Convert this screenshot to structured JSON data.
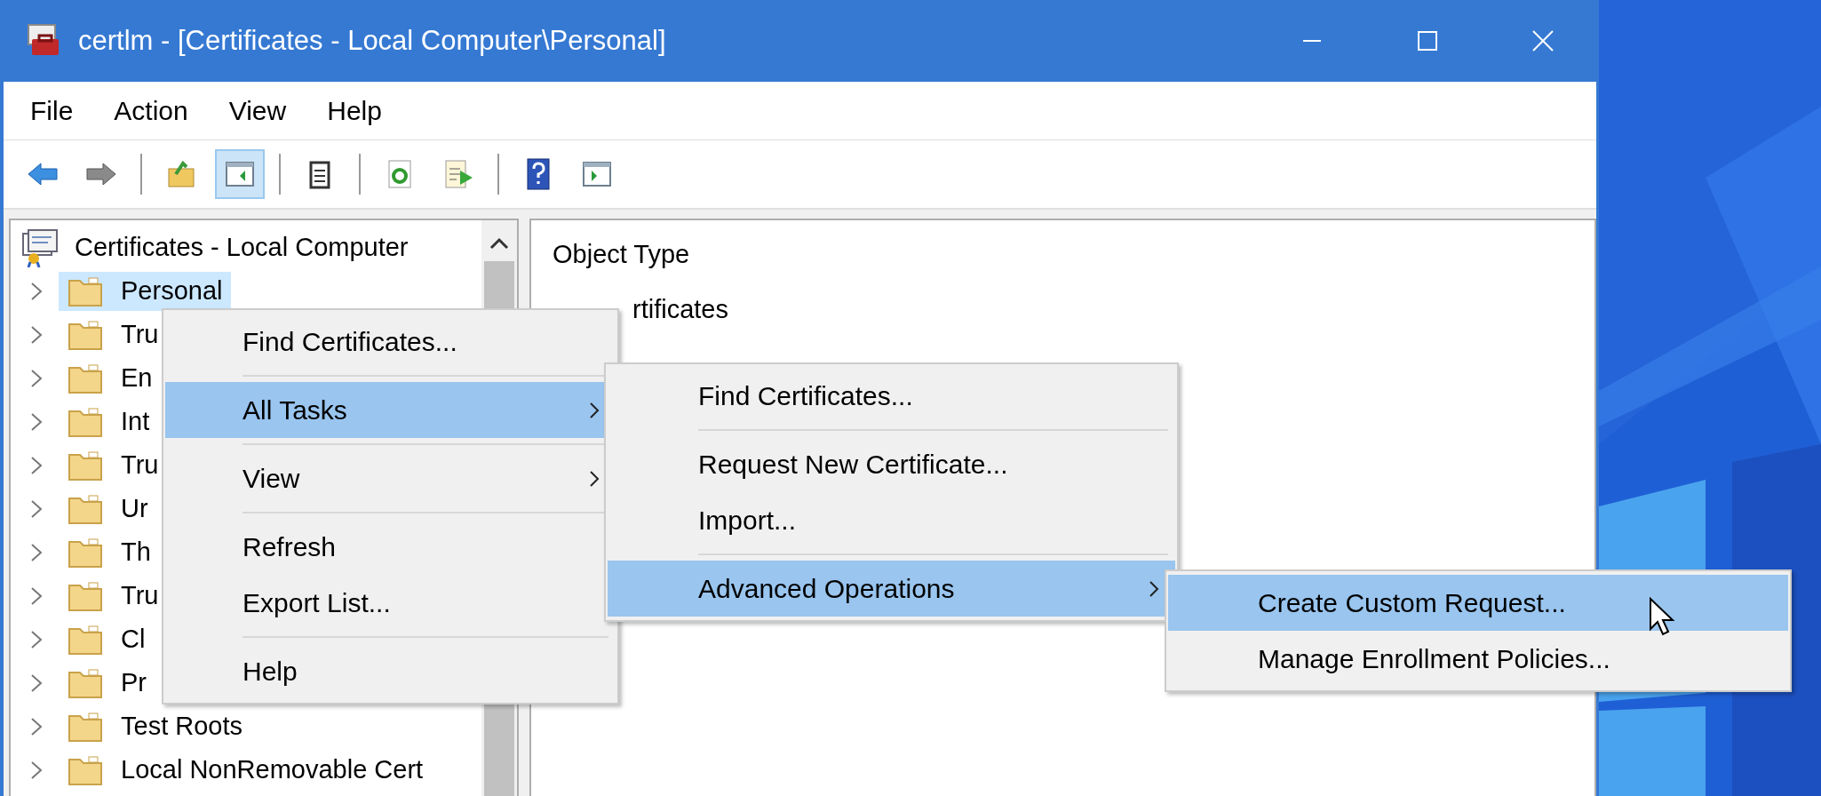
{
  "window": {
    "title": "certlm - [Certificates - Local Computer\\Personal]"
  },
  "menu_bar": [
    "File",
    "Action",
    "View",
    "Help"
  ],
  "toolbar": [
    [
      {
        "kind": "back",
        "pressed": false
      },
      {
        "kind": "forward",
        "pressed": false
      }
    ],
    [
      {
        "kind": "up",
        "pressed": false
      },
      {
        "kind": "tree",
        "pressed": true
      }
    ],
    [
      {
        "kind": "properties",
        "pressed": false
      }
    ],
    [
      {
        "kind": "refresh",
        "pressed": false
      },
      {
        "kind": "export",
        "pressed": false
      }
    ],
    [
      {
        "kind": "help",
        "pressed": false
      },
      {
        "kind": "pane",
        "pressed": false
      }
    ]
  ],
  "tree": {
    "root": "Certificates - Local Computer",
    "items": [
      {
        "label": "Personal",
        "selected": true
      },
      {
        "label": "Tru",
        "selected": false
      },
      {
        "label": "En",
        "selected": false
      },
      {
        "label": "Int",
        "selected": false
      },
      {
        "label": "Tru",
        "selected": false
      },
      {
        "label": "Ur",
        "selected": false
      },
      {
        "label": "Th",
        "selected": false
      },
      {
        "label": "Tru",
        "selected": false
      },
      {
        "label": "Cl",
        "selected": false
      },
      {
        "label": "Pr",
        "selected": false
      },
      {
        "label": "Test Roots",
        "selected": false
      },
      {
        "label": "Local NonRemovable Cert",
        "selected": false
      }
    ]
  },
  "list": {
    "column": "Object Type",
    "items": [
      "rtificates"
    ]
  },
  "menus": [
    {
      "items": [
        {
          "kind": "item",
          "label": "Find Certificates...",
          "submenu": false,
          "selected": false
        },
        {
          "kind": "separator"
        },
        {
          "kind": "item",
          "label": "All Tasks",
          "submenu": true,
          "selected": true
        },
        {
          "kind": "separator"
        },
        {
          "kind": "item",
          "label": "View",
          "submenu": true,
          "selected": false
        },
        {
          "kind": "separator"
        },
        {
          "kind": "item",
          "label": "Refresh",
          "submenu": false,
          "selected": false
        },
        {
          "kind": "item",
          "label": "Export List...",
          "submenu": false,
          "selected": false
        },
        {
          "kind": "separator"
        },
        {
          "kind": "item",
          "label": "Help",
          "submenu": false,
          "selected": false
        }
      ]
    },
    {
      "items": [
        {
          "kind": "item",
          "label": "Find Certificates...",
          "submenu": false,
          "selected": false
        },
        {
          "kind": "separator"
        },
        {
          "kind": "item",
          "label": "Request New Certificate...",
          "submenu": false,
          "selected": false
        },
        {
          "kind": "item",
          "label": "Import...",
          "submenu": false,
          "selected": false
        },
        {
          "kind": "separator"
        },
        {
          "kind": "item",
          "label": "Advanced Operations",
          "submenu": true,
          "selected": true
        }
      ]
    },
    {
      "items": [
        {
          "kind": "item",
          "label": "Create Custom Request...",
          "submenu": false,
          "selected": true
        },
        {
          "kind": "item",
          "label": "Manage Enrollment Policies...",
          "submenu": false,
          "selected": false
        }
      ]
    }
  ]
}
